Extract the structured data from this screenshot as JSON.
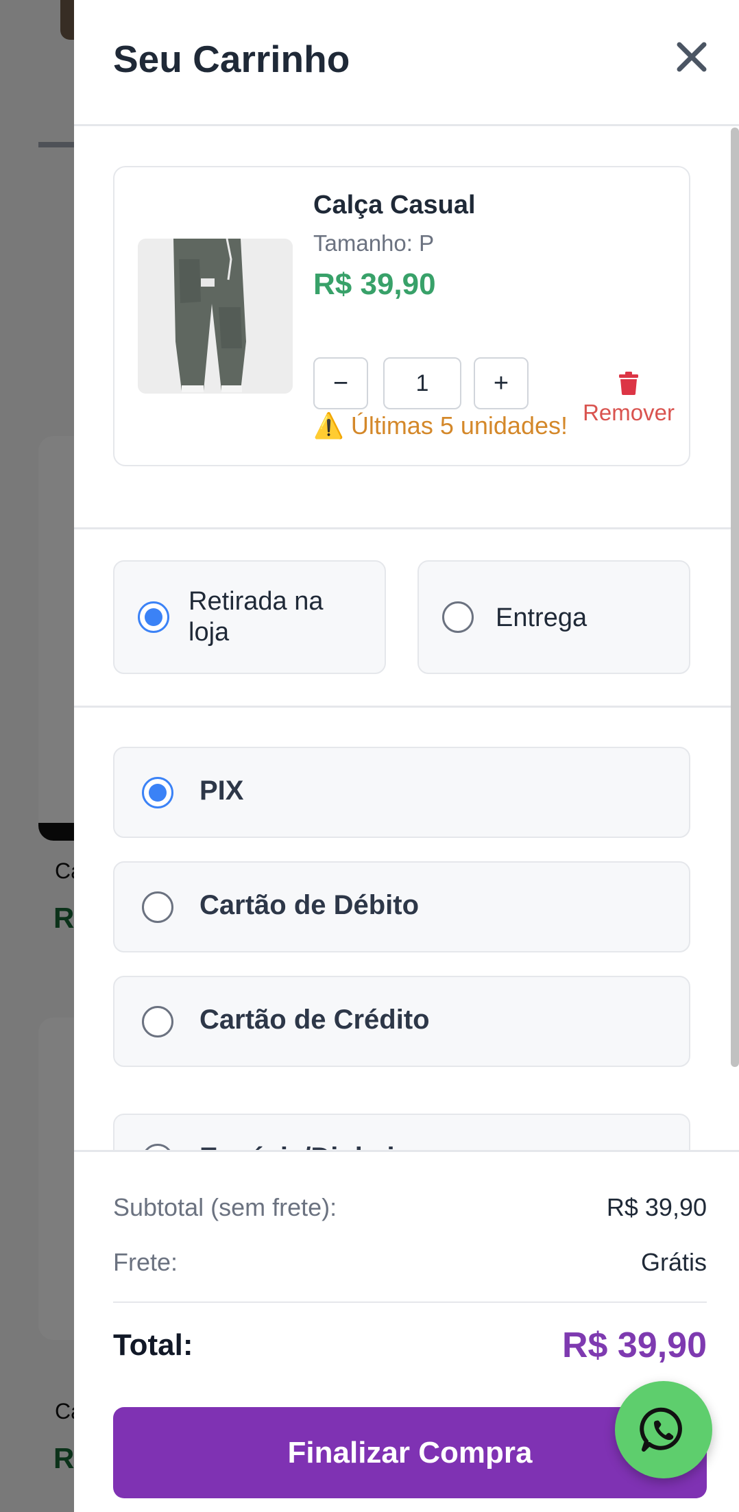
{
  "cart": {
    "title": "Seu Carrinho",
    "item": {
      "name": "Calça Casual",
      "size_label": "Tamanho: P",
      "price": "R$ 39,90",
      "quantity": "1",
      "minus_label": "−",
      "plus_label": "+",
      "remove_label": "Remover",
      "stock_warning": "⚠️ Últimas 5 unidades!"
    },
    "delivery_options": {
      "pickup": "Retirada na loja",
      "shipping": "Entrega",
      "selected": "pickup"
    },
    "payment_options": {
      "items": [
        "PIX",
        "Cartão de Débito",
        "Cartão de Crédito",
        "Espécie/Dinheiro"
      ],
      "selected": "PIX"
    },
    "summary": {
      "subtotal_label": "Subtotal (sem frete):",
      "subtotal_value": "R$ 39,90",
      "shipping_label": "Frete:",
      "shipping_value": "Grátis",
      "total_label": "Total:",
      "total_value": "R$ 39,90"
    },
    "checkout_label": "Finalizar Compra"
  },
  "background": {
    "card_text_1": "Ca",
    "card_price_1": "R",
    "card_text_2": "Ca",
    "card_price_2": "R"
  },
  "colors": {
    "accent": "#7f32b3",
    "price_green": "#38a169",
    "radio_blue": "#3b82f6",
    "remove_red": "#d9534f",
    "warning_orange": "#d4882a",
    "whatsapp_green": "#5ece6d"
  },
  "icons": {
    "close": "close-icon",
    "trash": "trash-icon",
    "warning": "warning-icon",
    "whatsapp": "whatsapp-icon"
  }
}
